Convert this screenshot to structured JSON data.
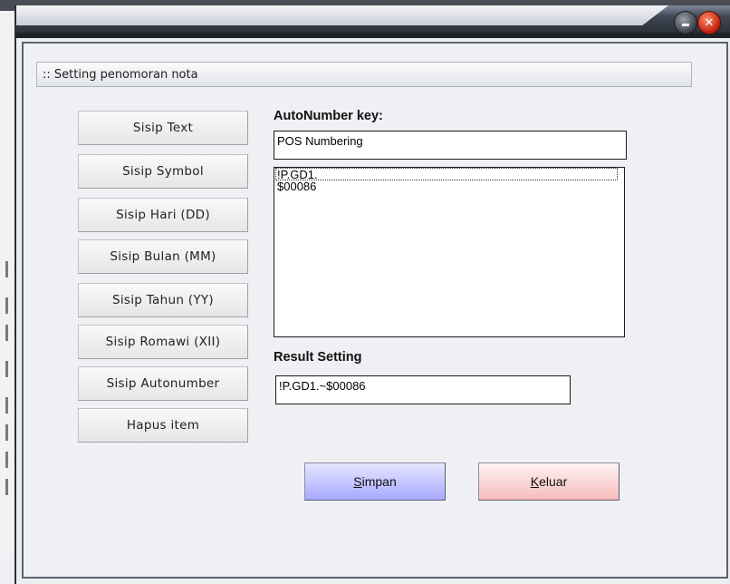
{
  "window": {
    "title": ""
  },
  "dialog": {
    "header": ":: Setting penomoran nota"
  },
  "buttons": [
    {
      "label": "Sisip Text"
    },
    {
      "label": "Sisip Symbol"
    },
    {
      "label": "Sisip Hari (DD)"
    },
    {
      "label": "Sisip Bulan (MM)"
    },
    {
      "label": "Sisip Tahun (YY)"
    },
    {
      "label": "Sisip Romawi (XII)"
    },
    {
      "label": "Sisip Autonumber"
    },
    {
      "label": "Hapus item"
    }
  ],
  "autonumber": {
    "label": "AutoNumber key:",
    "value": "POS Numbering"
  },
  "list": {
    "items": [
      "!P.GD1.",
      "$00086"
    ],
    "selected_index": 0
  },
  "result": {
    "label": "Result Setting",
    "value": "!P.GD1.~$00086"
  },
  "actions": {
    "save_mnemonic": "S",
    "save_rest": "impan",
    "exit_mnemonic": "K",
    "exit_rest": "eluar"
  },
  "colors": {
    "save_button": "#a7a9ff",
    "exit_button": "#f5bcbc",
    "title_bar": "#262b33",
    "close_button": "#c01d0c"
  },
  "icons": {
    "minimize": "minimize-icon",
    "close": "close-icon"
  }
}
